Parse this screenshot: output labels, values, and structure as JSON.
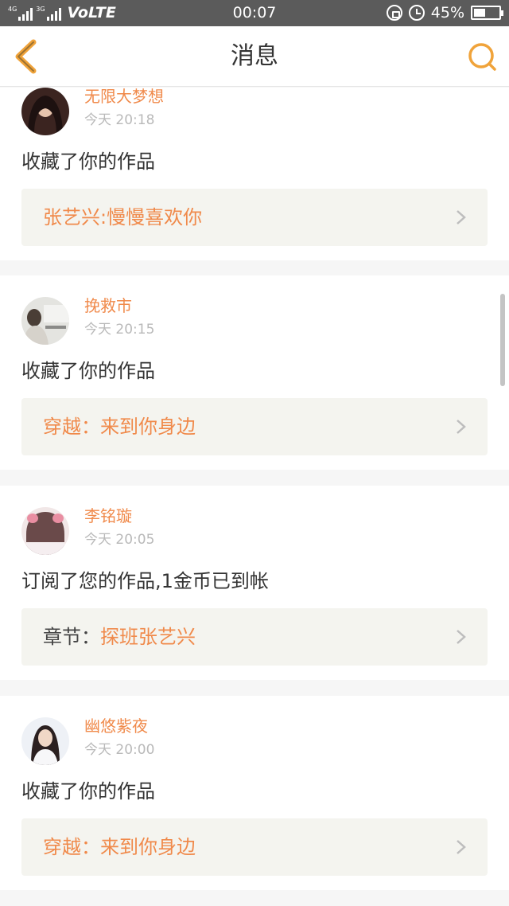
{
  "status_bar": {
    "network_a": "4G",
    "network_b": "3G",
    "volte": "VoLTE",
    "time": "00:07",
    "battery_text": "45%",
    "battery_level": 0.45
  },
  "header": {
    "title": "消息",
    "back_icon": "chevron-left-icon",
    "search_icon": "search-icon",
    "accent_color": "#f0a33a"
  },
  "colors": {
    "username": "#f08a4b",
    "work_title": "#f08a4b",
    "body_text": "#333333",
    "timestamp": "#b9b9b9",
    "card_background": "#f4f4ef"
  },
  "messages": [
    {
      "username": "无限大梦想",
      "time": "今天 20:18",
      "action": "收藏了你的作品",
      "work_prefix": "",
      "work_title": "张艺兴:慢慢喜欢你"
    },
    {
      "username": "挽救市",
      "time": "今天 20:15",
      "action": "收藏了你的作品",
      "work_prefix": "",
      "work_title": "穿越：来到你身边"
    },
    {
      "username": "李铭璇",
      "time": "今天 20:05",
      "action": "订阅了您的作品,1金币已到帐",
      "work_prefix": "章节：",
      "work_title": "探班张艺兴"
    },
    {
      "username": "幽悠紫夜",
      "time": "今天 20:00",
      "action": "收藏了你的作品",
      "work_prefix": "",
      "work_title": "穿越：来到你身边"
    }
  ]
}
